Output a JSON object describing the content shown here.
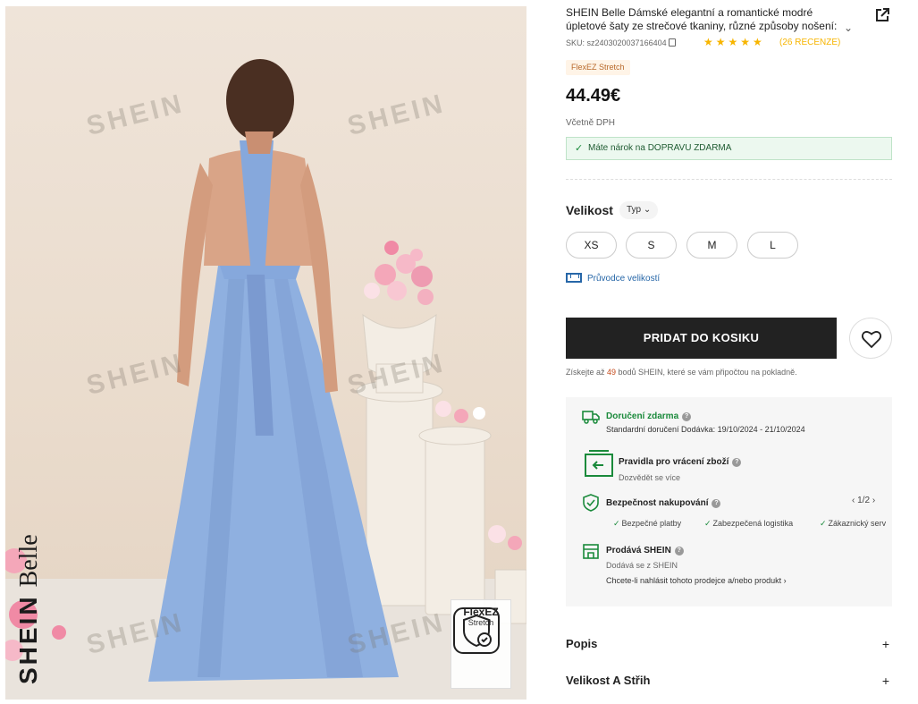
{
  "product": {
    "title": "SHEIN Belle Dámské elegantní a romantické modré úpletové šaty ze strečové tkaniny, různé způsoby nošení:",
    "sku_label": "SKU: sz2403020037166404",
    "rating_stars": "★★★★★",
    "rating": 4.5,
    "reviews_label": "(26 RECENZE)",
    "tag": "FlexEZ Stretch",
    "price": "44.49€",
    "vat_note": "Včetně DPH",
    "free_shipping": "Máte nárok na DOPRAVU ZDARMA"
  },
  "image": {
    "watermark": "SHEIN",
    "brand_bold": "SHEIN",
    "brand_script": "Belle",
    "badge_title": "FlexEZ",
    "badge_sub": "Stretch"
  },
  "size": {
    "label": "Velikost",
    "type_button": "Typ",
    "options": [
      "XS",
      "S",
      "M",
      "L"
    ],
    "guide": "Průvodce velikostí"
  },
  "actions": {
    "add_to_cart": "PRIDAT DO KOSIKU",
    "points_prefix": "Získejte až ",
    "points_value": "49",
    "points_suffix": " bodů SHEIN, které se vám připočtou na pokladně."
  },
  "info": {
    "delivery_title": "Doručení zdarma",
    "delivery_sub": "Standardní doručení Dodávka: 19/10/2024 - 21/10/2024",
    "returns_title": "Pravidla pro vrácení zboží",
    "returns_sub": "Dozvědět se více",
    "safety_title": "Bezpečnost nakupování",
    "pager": "1/2",
    "guarantees": [
      "Bezpečné platby",
      "Zabezpečená logistika",
      "Zákaznický serv"
    ],
    "seller_title": "Prodává SHEIN",
    "seller_sub": "Dodává se z SHEIN",
    "report": "Chcete-li nahlásit tohoto prodejce a/nebo produkt"
  },
  "accordion": [
    {
      "label": "Popis"
    },
    {
      "label": "Velikost A Střih"
    }
  ],
  "colors": {
    "accent": "#222222",
    "star": "#f7b500",
    "green": "#1a8a3b",
    "link": "#2767a8",
    "dress": "#8fb0e0"
  },
  "icons": [
    "share-icon",
    "copy-icon",
    "chevron-down-icon",
    "check-icon",
    "ruler-icon",
    "heart-icon",
    "truck-icon",
    "return-box-icon",
    "shield-check-icon",
    "store-icon",
    "help-icon"
  ]
}
